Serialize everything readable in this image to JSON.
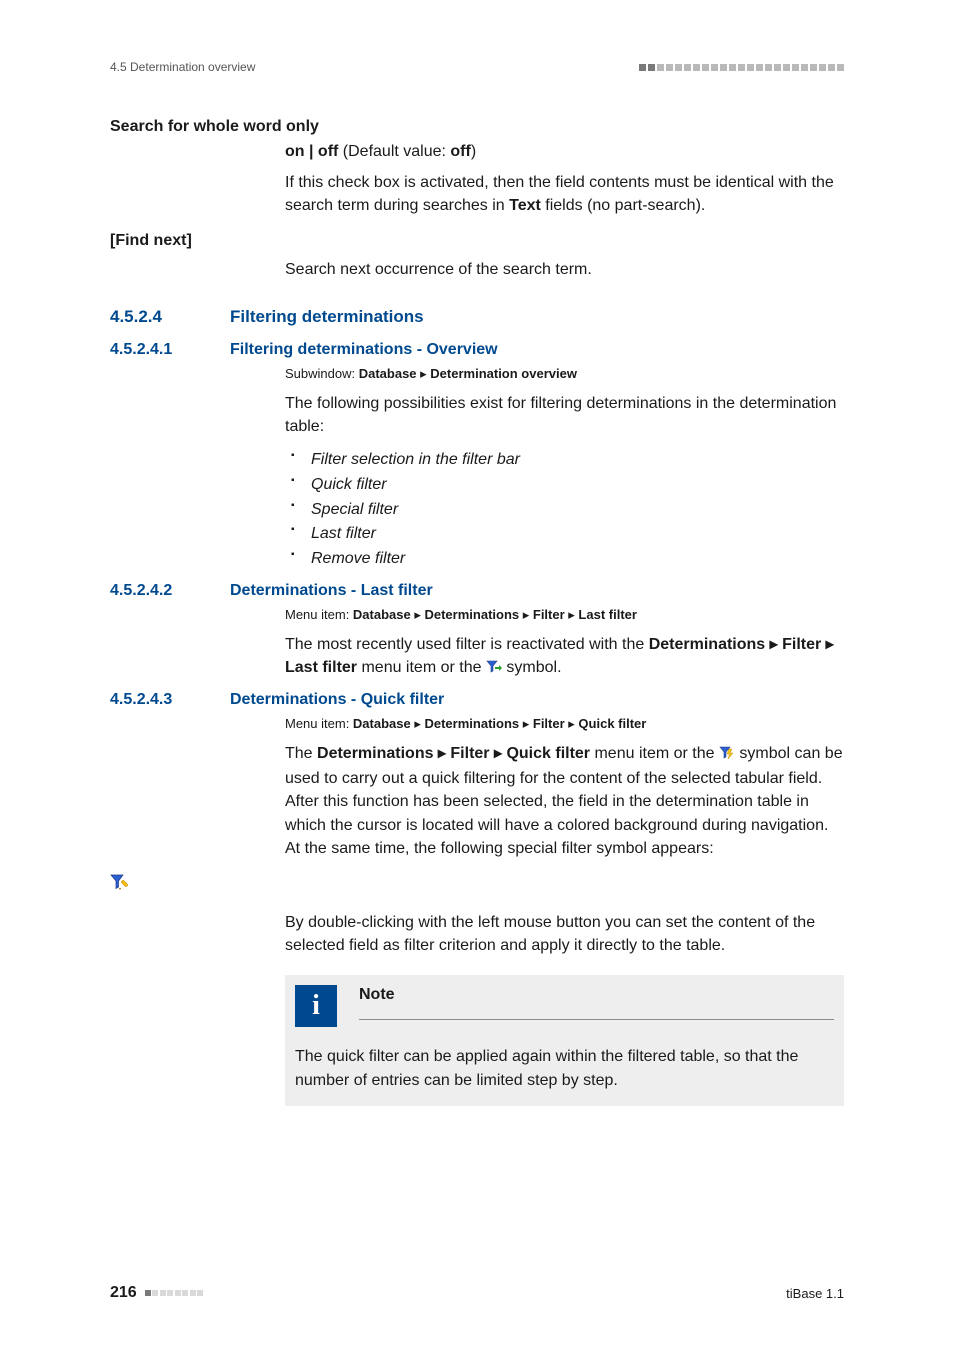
{
  "header": {
    "breadcrumb": "4.5 Determination overview"
  },
  "s1": {
    "title": "Search for whole word only",
    "line1_part1": "on | off",
    "line1_part2": " (Default value: ",
    "line1_part3": "off",
    "line1_part4": ")",
    "body_a": "If this check box is activated, then the field contents must be identical with the search term during searches in ",
    "body_b": "Text",
    "body_c": " fields (no part-search)."
  },
  "s2": {
    "title": "[Find next]",
    "body": "Search next occurrence of the search term."
  },
  "h_filter": {
    "num": "4.5.2.4",
    "title": "Filtering determinations"
  },
  "h_ov": {
    "num": "4.5.2.4.1",
    "title": "Filtering determinations - Overview",
    "sub_a": "Subwindow: ",
    "sub_b": "Database",
    "sub_c": " ▸ ",
    "sub_d": "Determination overview",
    "intro": "The following possibilities exist for filtering determinations in the determination table:",
    "items": [
      "Filter selection in the filter bar",
      "Quick filter",
      "Special filter",
      "Last filter",
      "Remove filter"
    ]
  },
  "h_last": {
    "num": "4.5.2.4.2",
    "title": "Determinations - Last filter",
    "menu_a": "Menu item: ",
    "menu_b": "Database",
    "menu_sep": " ▸ ",
    "menu_c": "Determinations",
    "menu_d": "Filter",
    "menu_e": "Last filter",
    "body_a": "The most recently used filter is reactivated with the ",
    "body_b": "Determinations",
    "body_c": "Filter",
    "body_d": "Last filter",
    "body_e": " menu item or the ",
    "body_f": " symbol."
  },
  "h_quick": {
    "num": "4.5.2.4.3",
    "title": "Determinations - Quick filter",
    "menu_a": "Menu item: ",
    "menu_b": "Database",
    "menu_sep": " ▸ ",
    "menu_c": "Determinations",
    "menu_d": "Filter",
    "menu_e": "Quick filter",
    "body_a": "The ",
    "body_b": "Determinations",
    "body_c": "Filter",
    "body_d": "Quick filter",
    "body_e": " menu item or the ",
    "body_f": " symbol can be used to carry out a quick filtering for the content of the selected tabular field. After this function has been selected, the field in the determination table in which the cursor is located will have a colored background during navigation. At the same time, the following special filter symbol appears:",
    "body_g": "By double-clicking with the left mouse button you can set the content of the selected field as filter criterion and apply it directly to the table."
  },
  "note": {
    "title": "Note",
    "body": "The quick filter can be applied again within the filtered table, so that the number of entries can be limited step by step."
  },
  "footer": {
    "page": "216",
    "product": "tiBase 1.1"
  }
}
